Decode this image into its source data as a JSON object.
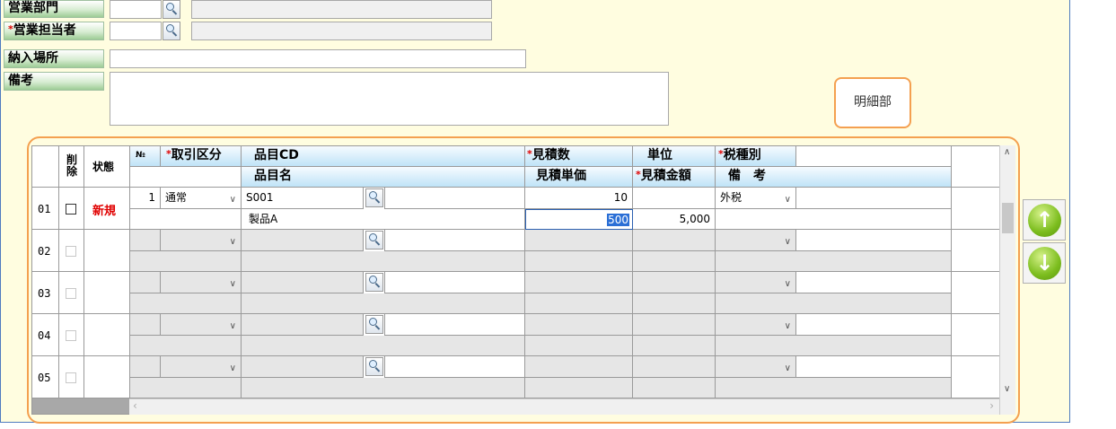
{
  "header_fields": {
    "sales_dept_label": "営業部門",
    "sales_rep_label": "営業担当者",
    "delivery_place_label": "納入場所",
    "remarks_label": "備考",
    "required_mark": "*"
  },
  "callout": {
    "text": "明細部"
  },
  "grid_header": {
    "no": "№",
    "delete": "削除",
    "status": "状態",
    "trade_type": "取引区分",
    "item_cd": "品目CD",
    "item_name": "品目名",
    "quote_qty": "見積数",
    "unit": "単位",
    "tax_type": "税種別",
    "quote_unit_price": "見積単価",
    "quote_amount": "見積金額",
    "remarks": "備　考",
    "required_mark": "*"
  },
  "rows": [
    {
      "row_no": "01",
      "status": "新規",
      "no": "1",
      "trade_type": "通常",
      "item_cd": "S001",
      "item_name": "製品A",
      "quote_qty": "10",
      "unit": "",
      "tax_type": "外税",
      "unit_price": "500",
      "amount": "5,000"
    },
    {
      "row_no": "02"
    },
    {
      "row_no": "03"
    },
    {
      "row_no": "04"
    },
    {
      "row_no": "05"
    }
  ],
  "colors": {
    "status_new": "#e00000",
    "required": "#e00000",
    "callout_border": "#f4a050",
    "panel_bg": "#fffde0",
    "button_green": "#7cbd1e"
  },
  "icons": {
    "search": "search-icon",
    "up": "arrow-up-icon",
    "down": "arrow-down-icon",
    "dropdown": "chevron-down-icon"
  }
}
